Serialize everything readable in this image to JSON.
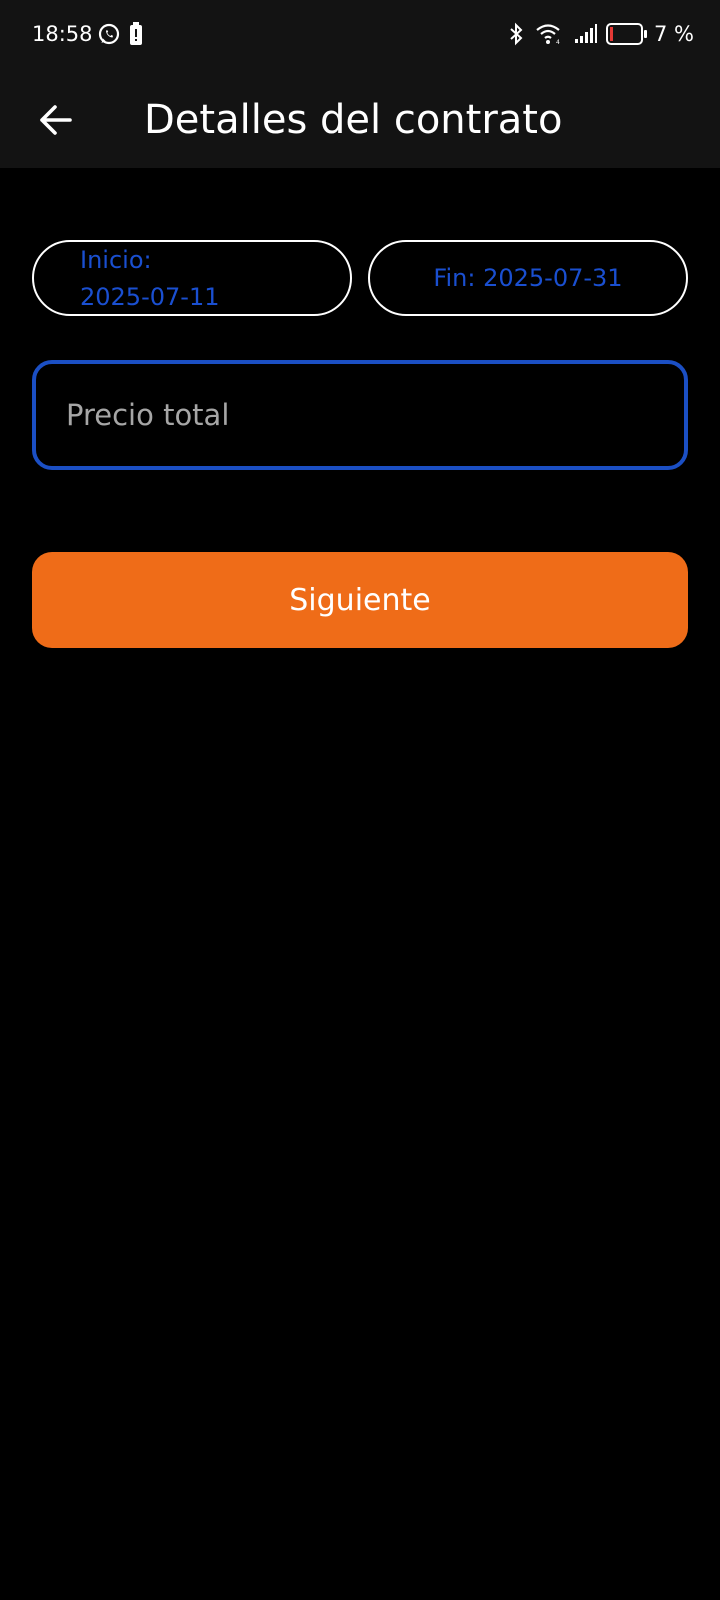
{
  "status_bar": {
    "time": "18:58",
    "battery_percent": "7 %",
    "icons": [
      "whatsapp-icon",
      "battery-alert-icon",
      "bluetooth-icon",
      "wifi-icon",
      "signal-icon",
      "battery-icon"
    ]
  },
  "app_bar": {
    "title": "Detalles del contrato",
    "back_icon": "arrow-left-icon"
  },
  "form": {
    "start_date": {
      "label": "Inicio:",
      "value": "2025-07-11"
    },
    "end_date": {
      "text": "Fin: 2025-07-31"
    },
    "total_price": {
      "placeholder": "Precio total",
      "value": ""
    },
    "next_button": "Siguiente"
  },
  "colors": {
    "background": "#000000",
    "app_bar": "#131313",
    "date_text": "#1a4fd0",
    "field_border_focused": "#1b4fc4",
    "accent_button": "#ef6c18",
    "placeholder_text": "#a6a6a6"
  }
}
